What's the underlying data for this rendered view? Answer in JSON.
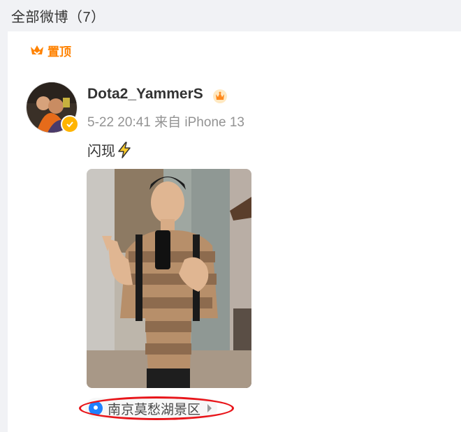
{
  "header": {
    "title": "全部微博（7）"
  },
  "pinned": {
    "label": "置顶",
    "icon": "pin-crown-icon"
  },
  "post": {
    "username": "Dota2_YammerS",
    "meta": "5-22 20:41 来自 iPhone 13",
    "text": "闪现",
    "location": "南京莫愁湖景区"
  },
  "colors": {
    "accent": "#ff8200",
    "highlight": "#e8151a",
    "verified": "#ffb400",
    "location_icon": "#1e80ff"
  },
  "icons": [
    "pin-crown-icon",
    "verified-badge-icon",
    "crown-icon",
    "lightning-icon",
    "location-icon",
    "chevron-right-icon"
  ]
}
